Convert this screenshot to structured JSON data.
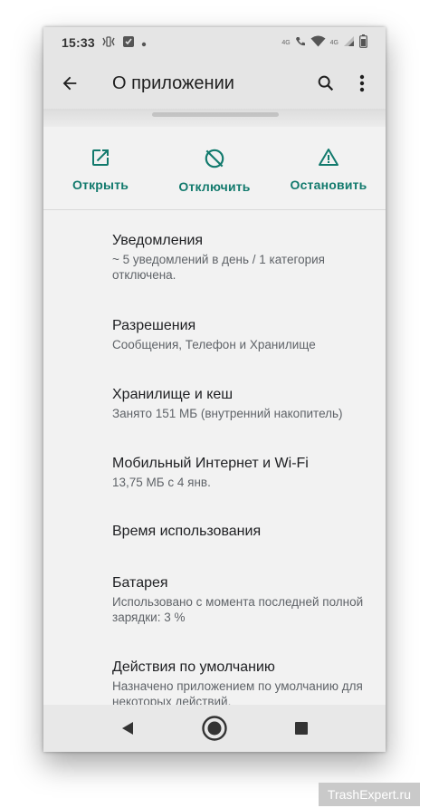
{
  "status": {
    "time": "15:33",
    "net_left": "4G",
    "net_right": "4G"
  },
  "appbar": {
    "title": "О приложении"
  },
  "actions": [
    {
      "label": "Открыть",
      "icon": "open-in-new-icon"
    },
    {
      "label": "Отключить",
      "icon": "disable-icon"
    },
    {
      "label": "Остановить",
      "icon": "warning-icon"
    }
  ],
  "settings": [
    {
      "title": "Уведомления",
      "subtitle": "~ 5 уведомлений в день / 1 категория отключена."
    },
    {
      "title": "Разрешения",
      "subtitle": "Сообщения, Телефон и Хранилище"
    },
    {
      "title": "Хранилище и кеш",
      "subtitle": "Занято 151 МБ (внутренний накопитель)"
    },
    {
      "title": "Мобильный Интернет и Wi-Fi",
      "subtitle": "13,75 МБ с 4 янв."
    },
    {
      "title": "Время использования",
      "subtitle": ""
    },
    {
      "title": "Батарея",
      "subtitle": "Использовано с момента последней полной зарядки: 3 %"
    },
    {
      "title": "Действия по умолчанию",
      "subtitle": "Назначено приложением по умолчанию для некоторых действий."
    }
  ],
  "watermark": "TrashExpert.ru",
  "colors": {
    "accent": "#127a6d",
    "bar_bg": "#e5e5e5",
    "content_bg": "#f2f2f2"
  }
}
